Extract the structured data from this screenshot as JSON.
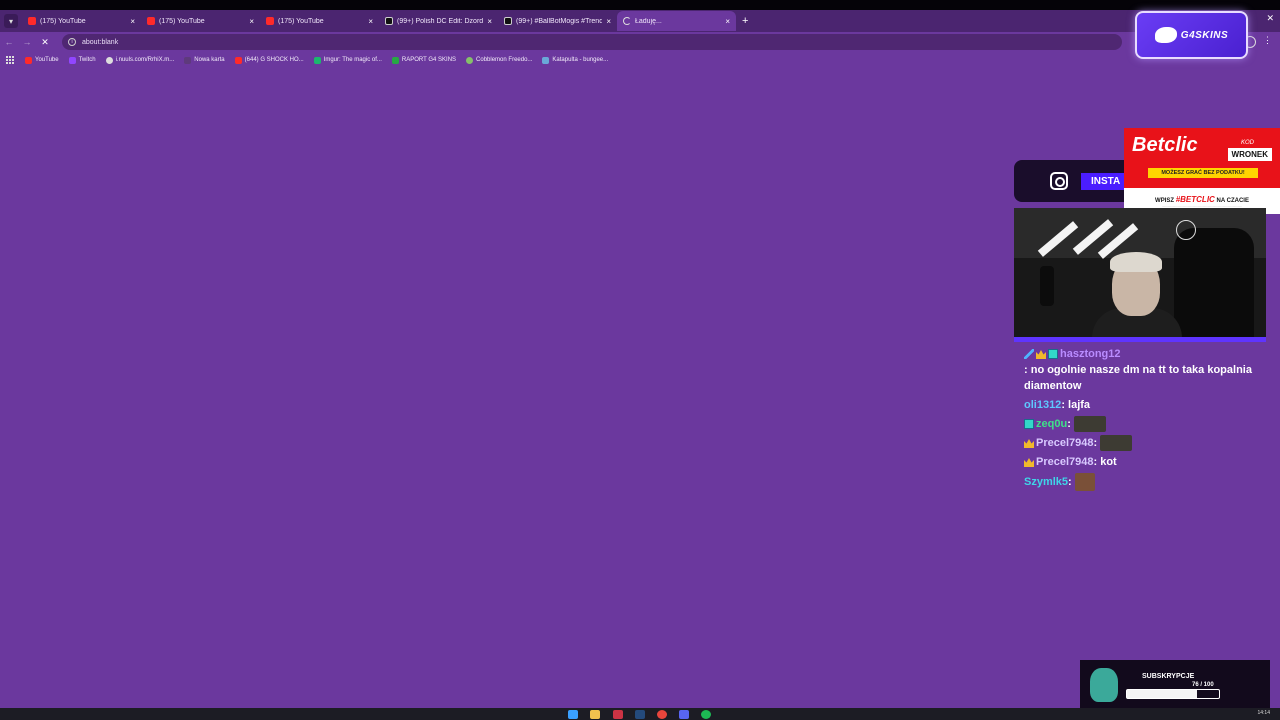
{
  "browser": {
    "tabs": [
      {
        "title": "(175) YouTube",
        "icon": "youtube-icon"
      },
      {
        "title": "(175) YouTube",
        "icon": "youtube-icon"
      },
      {
        "title": "(175) YouTube",
        "icon": "youtube-icon"
      },
      {
        "title": "(99+) Polish DC Edit: Dzordzo I",
        "icon": "tiktok-icon"
      },
      {
        "title": "(99+) #BallBotMogis #Trending",
        "icon": "tiktok-icon"
      },
      {
        "title": "Ładuję...",
        "icon": "loading-icon"
      }
    ],
    "close_glyph": "×",
    "new_tab_glyph": "+",
    "window_close_glyph": "✕",
    "address": "about:blank",
    "bookmarks": [
      {
        "label": "YouTube",
        "icon": "yt"
      },
      {
        "label": "Twitch",
        "icon": "tw"
      },
      {
        "label": "i.nuuls.com/RrhiX.m...",
        "icon": "gl"
      },
      {
        "label": "Nowa karta",
        "icon": "nk"
      },
      {
        "label": "(644) G SHOCK HO...",
        "icon": "yt"
      },
      {
        "label": "Imgur: The magic of...",
        "icon": "im"
      },
      {
        "label": "RAPORT G4 SKINS",
        "icon": "gr"
      },
      {
        "label": "Cobblemon Freedo...",
        "icon": "cb"
      },
      {
        "label": "Katapulta - bungee...",
        "icon": "kt"
      }
    ]
  },
  "overlay": {
    "logo_text": "G4SKINS",
    "instagram_label": "INSTA",
    "betclic": {
      "brand": "Betclic",
      "kod": "KOD",
      "code": "WRONEK",
      "note": "MOŻESZ GRAĆ BEZ PODATKU!",
      "cta_prefix": "WPISZ",
      "cta_code": "#BETCLIC",
      "cta_suffix": "NA CZACIE"
    },
    "chat": [
      {
        "user": "hasztong12",
        "user_color": "#b98cff",
        "badges": [
          "sword",
          "crown",
          "grid"
        ],
        "text": ": no ogolnie nasze dm na tt to taka kopalnia diamentow"
      },
      {
        "user": "oli1312",
        "user_color": "#5ec8ff",
        "badges": [],
        "text": ": lajfa"
      },
      {
        "user": "zeq0u",
        "user_color": "#3fe089",
        "badges": [
          "grid"
        ],
        "text": ":",
        "emote": "wide"
      },
      {
        "user": "Precel7948",
        "user_color": "#d8c9ff",
        "badges": [
          "crown"
        ],
        "text": ":",
        "emote": "wide"
      },
      {
        "user": "Precel7948",
        "user_color": "#d8c9ff",
        "badges": [
          "crown"
        ],
        "text": ": kot"
      },
      {
        "user": "Szymlk5",
        "user_color": "#3fd5e8",
        "badges": [],
        "text": ":",
        "emote": "small"
      }
    ],
    "subs": {
      "title": "SUBSKRYPCJE",
      "count": "76  / 100",
      "progress": 0.76
    }
  },
  "taskbar": {
    "time": "14:14"
  }
}
